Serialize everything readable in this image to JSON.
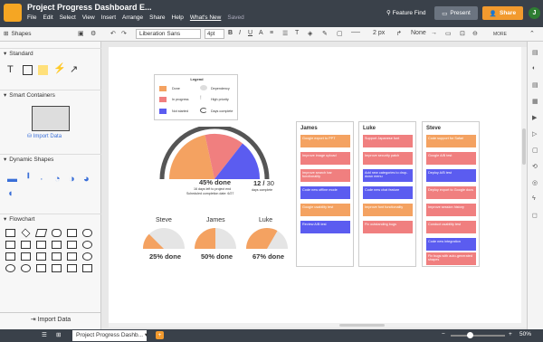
{
  "app": {
    "title": "Project Progress Dashboard E...",
    "menu": [
      "File",
      "Edit",
      "Select",
      "View",
      "Insert",
      "Arrange",
      "Share",
      "Help",
      "What's New",
      "Saved"
    ],
    "feature_find": "Feature Find",
    "present": "Present",
    "share": "Share",
    "avatar": "J"
  },
  "toolbar": {
    "shapes": "Shapes",
    "font": "Liberation Sans",
    "pt": "4pt",
    "stroke": "2 px",
    "arrow": "None",
    "more": "MORE"
  },
  "sidebar": {
    "standard": "Standard",
    "smart": "Smart Containers",
    "import_data": "Import Data",
    "dynamic": "Dynamic Shapes",
    "flowchart": "Flowchart",
    "import_bottom": "Import Data"
  },
  "bottom": {
    "page": "Project Progress Dashb...",
    "zoom": "50%"
  },
  "legend": {
    "title": "Legend",
    "done": "Done",
    "in_progress": "In progress",
    "not_started": "Not started",
    "dependency": "Dependency",
    "high_priority": "High priority",
    "days_complete": "Days complete"
  },
  "main_gauge": {
    "done": "45% done",
    "days_left": "16 days left to project end",
    "scheduled": "Scheduled completion date: 6/27",
    "days_count": "12",
    "days_total": "30",
    "days_label": "days complete"
  },
  "mini": [
    {
      "name": "Steve",
      "done": "25% done"
    },
    {
      "name": "James",
      "done": "50% done"
    },
    {
      "name": "Luke",
      "done": "67% done"
    }
  ],
  "columns": [
    {
      "head": "James",
      "cards": [
        "Google export to PPT",
        "Improve image upload",
        "Improve search bar functionality",
        "Code new offline mode",
        "Google usability test",
        "Review A/B test"
      ]
    },
    {
      "head": "Luke",
      "cards": [
        "Support Japanese font",
        "Improve security patch",
        "Add new categories to drop-down menu",
        "Code new chat feature",
        "Improve font functionality",
        "Fix outstanding bugs"
      ]
    },
    {
      "head": "Steve",
      "cards": [
        "Code support for Safari",
        "Google A/B test",
        "Deploy A/B test",
        "Deploy export to Google docs",
        "Improve session history",
        "Conduct usability test",
        "Code new integration",
        "Fix bugs with auto-generated shapes"
      ]
    }
  ],
  "colors": {
    "done": "#f4a261",
    "in_progress": "#f07f7f",
    "not_started": "#5b5cf0",
    "gauge_track": "#555555",
    "mini_track": "#e5e5e5"
  }
}
